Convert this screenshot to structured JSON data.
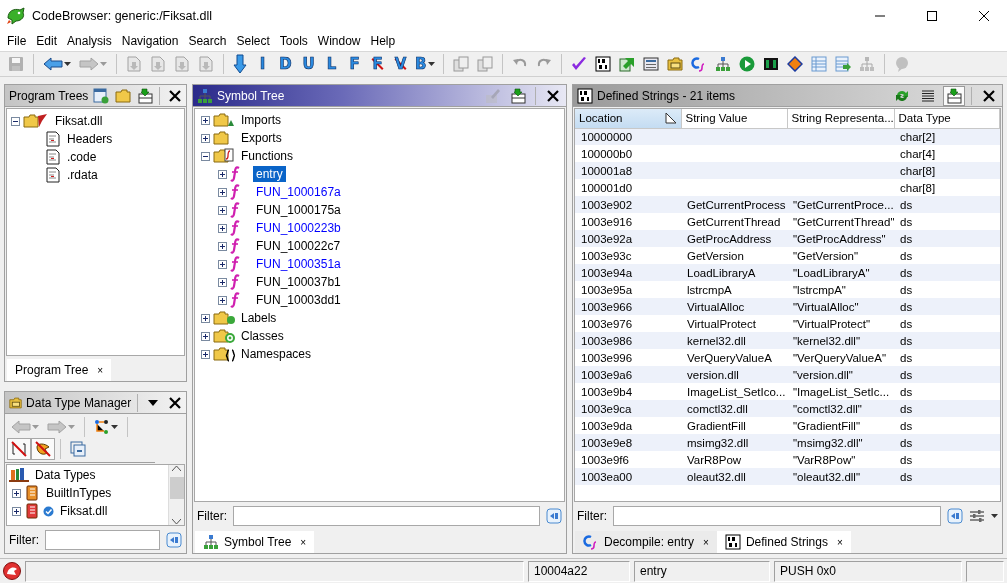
{
  "window": {
    "title": "CodeBrowser: generic:/Fiksat.dll"
  },
  "menu": [
    {
      "label": "File"
    },
    {
      "label": "Edit"
    },
    {
      "label": "Analysis"
    },
    {
      "label": "Navigation"
    },
    {
      "label": "Search"
    },
    {
      "label": "Select"
    },
    {
      "label": "Tools"
    },
    {
      "label": "Window"
    },
    {
      "label": "Help"
    }
  ],
  "toolbar": [
    {
      "kind": "button",
      "disabled": true
    },
    {
      "kind": "separator"
    },
    {
      "kind": "button",
      "disabled": false,
      "dropdown": true
    },
    {
      "kind": "button",
      "disabled": true,
      "dropdown": true
    },
    {
      "kind": "separator"
    },
    {
      "kind": "button",
      "disabled": true
    },
    {
      "kind": "button",
      "disabled": true
    },
    {
      "kind": "button",
      "disabled": true
    },
    {
      "kind": "button",
      "disabled": true
    },
    {
      "kind": "separator"
    },
    {
      "kind": "button",
      "disabled": false
    },
    {
      "kind": "letter",
      "text": "I",
      "crossed": false
    },
    {
      "kind": "letter",
      "text": "D",
      "crossed": false
    },
    {
      "kind": "letter",
      "text": "U",
      "crossed": false
    },
    {
      "kind": "letter",
      "text": "L",
      "crossed": false
    },
    {
      "kind": "letter",
      "text": "F",
      "crossed": false
    },
    {
      "kind": "letter",
      "text": "F",
      "crossed": true
    },
    {
      "kind": "letter",
      "text": "V",
      "crossed": true
    },
    {
      "kind": "letter",
      "text": "B",
      "crossed": false,
      "dropdown": true
    },
    {
      "kind": "separator"
    },
    {
      "kind": "button",
      "disabled": true
    },
    {
      "kind": "button",
      "disabled": true
    },
    {
      "kind": "separator"
    },
    {
      "kind": "button",
      "disabled": true
    },
    {
      "kind": "button",
      "disabled": true
    },
    {
      "kind": "separator"
    },
    {
      "kind": "button",
      "disabled": false
    },
    {
      "kind": "button",
      "disabled": false
    },
    {
      "kind": "button",
      "disabled": false
    },
    {
      "kind": "button",
      "disabled": false
    },
    {
      "kind": "button",
      "disabled": false
    },
    {
      "kind": "button",
      "disabled": false
    },
    {
      "kind": "button",
      "disabled": false
    },
    {
      "kind": "button",
      "disabled": false
    },
    {
      "kind": "button",
      "disabled": false
    },
    {
      "kind": "button",
      "disabled": false
    },
    {
      "kind": "button",
      "disabled": false
    },
    {
      "kind": "button",
      "disabled": false
    },
    {
      "kind": "button",
      "disabled": true
    },
    {
      "kind": "separator"
    },
    {
      "kind": "button",
      "disabled": true
    }
  ],
  "program_trees": {
    "title": "Program Trees",
    "tree": {
      "label": "Fiksat.dll",
      "expanded": true,
      "children": [
        {
          "label": "Headers"
        },
        {
          "label": ".code"
        },
        {
          "label": ".rdata"
        }
      ]
    },
    "tabs": [
      {
        "label": "Program Tree",
        "selected": true,
        "close": "×"
      }
    ]
  },
  "data_type_manager": {
    "title": "Data Type Manager",
    "toolbar": [
      {
        "kind": "button",
        "disabled": true,
        "pressed": false,
        "dropdown": true
      },
      {
        "kind": "button",
        "disabled": true,
        "pressed": false,
        "dropdown": true
      },
      {
        "kind": "separator"
      },
      {
        "kind": "button",
        "disabled": false,
        "pressed": false,
        "dropdown": true
      },
      {
        "kind": "separator"
      },
      {
        "kind": "button",
        "disabled": false,
        "pressed": true
      },
      {
        "kind": "button",
        "disabled": false,
        "pressed": true
      },
      {
        "kind": "separator"
      },
      {
        "kind": "button",
        "disabled": false,
        "pressed": false
      }
    ],
    "tree": {
      "label": "Data Types",
      "children": [
        {
          "label": "BuiltInTypes",
          "expanded": false
        },
        {
          "label": "Fiksat.dll",
          "expanded": false
        }
      ]
    },
    "filter_label": "Filter:"
  },
  "symbol_tree": {
    "title": "Symbol Tree",
    "items": [
      {
        "label": "Imports",
        "expanded": false
      },
      {
        "label": "Exports",
        "expanded": false
      },
      {
        "label": "Functions",
        "expanded": true,
        "children": [
          {
            "label": "entry",
            "selected": true
          },
          {
            "label": "FUN_1000167a",
            "selected": false,
            "color": "#0000ff"
          },
          {
            "label": "FUN_1000175a",
            "selected": false,
            "color": "#000000"
          },
          {
            "label": "FUN_1000223b",
            "selected": false,
            "color": "#0000ff"
          },
          {
            "label": "FUN_100022c7",
            "selected": false,
            "color": "#000000"
          },
          {
            "label": "FUN_1000351a",
            "selected": false,
            "color": "#0000ff"
          },
          {
            "label": "FUN_100037b1",
            "selected": false,
            "color": "#000000"
          },
          {
            "label": "FUN_10003dd1",
            "selected": false,
            "color": "#000000"
          }
        ]
      },
      {
        "label": "Labels",
        "expanded": false
      },
      {
        "label": "Classes",
        "expanded": false
      },
      {
        "label": "Namespaces",
        "expanded": false
      }
    ],
    "filter_label": "Filter:",
    "tabs": [
      {
        "label": "Symbol Tree",
        "selected": true,
        "close": "×"
      }
    ]
  },
  "defined_strings": {
    "title": "Defined Strings - 21 items",
    "columns": [
      {
        "label": "Location",
        "sorted": true
      },
      {
        "label": "String Value",
        "sorted": false
      },
      {
        "label": "String Representa...",
        "sorted": false
      },
      {
        "label": "Data Type",
        "sorted": false
      }
    ],
    "rows": [
      {
        "location": "10000000",
        "data_type": "char[2]"
      },
      {
        "location": "100000b0",
        "data_type": "char[4]"
      },
      {
        "location": "100001a8",
        "data_type": "char[8]"
      },
      {
        "location": "100001d0",
        "data_type": "char[8]"
      },
      {
        "location": "1003e902",
        "string_value": "GetCurrentProcess",
        "string_representation": "\"GetCurrentProce...",
        "data_type": "ds"
      },
      {
        "location": "1003e916",
        "string_value": "GetCurrentThread",
        "string_representation": "\"GetCurrentThread\"",
        "data_type": "ds"
      },
      {
        "location": "1003e92a",
        "string_value": "GetProcAddress",
        "string_representation": "\"GetProcAddress\"",
        "data_type": "ds"
      },
      {
        "location": "1003e93c",
        "string_value": "GetVersion",
        "string_representation": "\"GetVersion\"",
        "data_type": "ds"
      },
      {
        "location": "1003e94a",
        "string_value": "LoadLibraryA",
        "string_representation": "\"LoadLibraryA\"",
        "data_type": "ds"
      },
      {
        "location": "1003e95a",
        "string_value": "lstrcmpA",
        "string_representation": "\"lstrcmpA\"",
        "data_type": "ds"
      },
      {
        "location": "1003e966",
        "string_value": "VirtualAlloc",
        "string_representation": "\"VirtualAlloc\"",
        "data_type": "ds"
      },
      {
        "location": "1003e976",
        "string_value": "VirtualProtect",
        "string_representation": "\"VirtualProtect\"",
        "data_type": "ds"
      },
      {
        "location": "1003e986",
        "string_value": "kernel32.dll",
        "string_representation": "\"kernel32.dll\"",
        "data_type": "ds"
      },
      {
        "location": "1003e996",
        "string_value": "VerQueryValueA",
        "string_representation": "\"VerQueryValueA\"",
        "data_type": "ds"
      },
      {
        "location": "1003e9a6",
        "string_value": "version.dll",
        "string_representation": "\"version.dll\"",
        "data_type": "ds"
      },
      {
        "location": "1003e9b4",
        "string_value": "ImageList_SetIco...",
        "string_representation": "\"ImageList_SetIc...",
        "data_type": "ds"
      },
      {
        "location": "1003e9ca",
        "string_value": "comctl32.dll",
        "string_representation": "\"comctl32.dll\"",
        "data_type": "ds"
      },
      {
        "location": "1003e9da",
        "string_value": "GradientFill",
        "string_representation": "\"GradientFill\"",
        "data_type": "ds"
      },
      {
        "location": "1003e9e8",
        "string_value": "msimg32.dll",
        "string_representation": "\"msimg32.dll\"",
        "data_type": "ds"
      },
      {
        "location": "1003e9f6",
        "string_value": "VarR8Pow",
        "string_representation": "\"VarR8Pow\"",
        "data_type": "ds"
      },
      {
        "location": "1003ea00",
        "string_value": "oleaut32.dll",
        "string_representation": "\"oleaut32.dll\"",
        "data_type": "ds"
      }
    ],
    "filter_label": "Filter:",
    "tabs": [
      {
        "label": "Decompile: entry",
        "selected": false,
        "close": "×"
      },
      {
        "label": "Defined Strings",
        "selected": true,
        "close": "×"
      }
    ]
  },
  "status_bar": {
    "fields": [
      {
        "text": "10004a22"
      },
      {
        "text": "entry"
      },
      {
        "text": "PUSH 0x0"
      }
    ]
  }
}
